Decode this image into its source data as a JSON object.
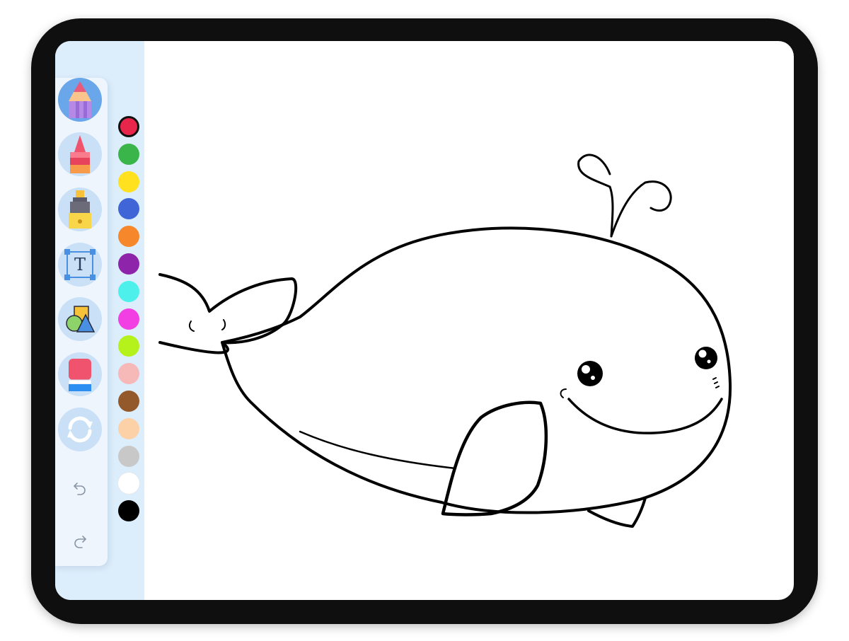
{
  "app": {
    "tools": [
      {
        "id": "pencil",
        "icon": "pencil-icon",
        "selected": true
      },
      {
        "id": "crayon",
        "icon": "crayon-icon",
        "selected": false
      },
      {
        "id": "marker",
        "icon": "marker-icon",
        "selected": false
      },
      {
        "id": "text",
        "icon": "text-tool-icon",
        "label": "T",
        "selected": false
      },
      {
        "id": "shapes",
        "icon": "shapes-icon",
        "selected": false
      },
      {
        "id": "eraser",
        "icon": "eraser-icon",
        "selected": false
      },
      {
        "id": "clear",
        "icon": "refresh-icon",
        "selected": false
      }
    ],
    "history": [
      {
        "id": "undo",
        "icon": "undo-icon"
      },
      {
        "id": "redo",
        "icon": "redo-icon"
      }
    ],
    "palette": {
      "selected_index": 0,
      "colors": [
        "#e8254a",
        "#3ab54a",
        "#ffe11f",
        "#3f65d6",
        "#f7872b",
        "#8e24aa",
        "#4ef0ec",
        "#f23fe4",
        "#b5f21c",
        "#f7b8b8",
        "#93592a",
        "#fdd1a8",
        "#c8c8c8",
        "#ffffff",
        "#000000"
      ]
    },
    "canvas": {
      "drawing": "whale-outline",
      "stroke_color": "#000000",
      "background": "#ffffff"
    }
  }
}
